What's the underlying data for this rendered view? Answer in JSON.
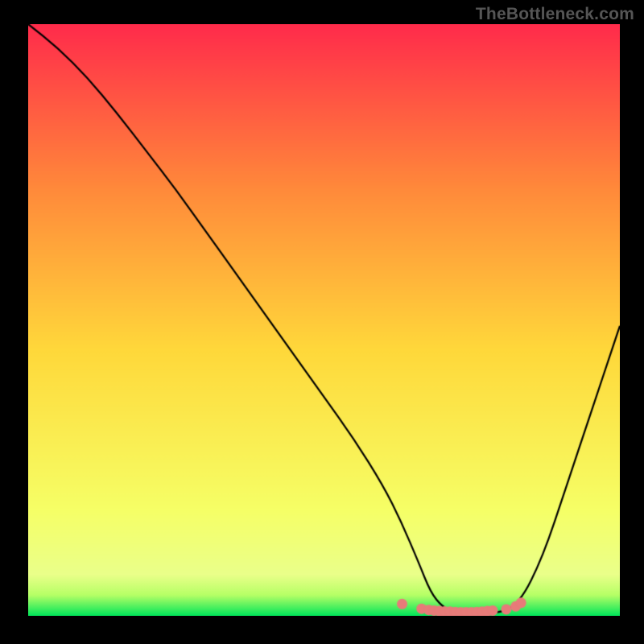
{
  "watermark": "TheBottleneck.com",
  "chart_data": {
    "type": "line",
    "title": "",
    "xlabel": "",
    "ylabel": "",
    "xlim": [
      0,
      100
    ],
    "ylim": [
      0,
      100
    ],
    "gradient": {
      "top": "#ff2b4b",
      "upper_mid": "#ff8a3a",
      "mid": "#ffd83a",
      "lower_mid": "#f6ff66",
      "near_bottom": "#b6ff66",
      "bottom": "#00e55a"
    },
    "curve": {
      "comment": "Black V-shaped bottleneck curve. y is percent bottleneck (100=top). Values read from plot; minimum plateau ~0 around x 68-82.",
      "x": [
        0,
        5,
        10,
        15,
        20,
        25,
        30,
        35,
        40,
        45,
        50,
        55,
        60,
        63,
        66,
        68,
        70,
        72,
        74,
        76,
        78,
        80,
        82,
        84,
        86,
        88,
        90,
        92,
        94,
        96,
        98,
        100
      ],
      "y": [
        100,
        96,
        91,
        85,
        78.5,
        72,
        65,
        58,
        51,
        44,
        37,
        30,
        22,
        16,
        9,
        4,
        1.5,
        0.7,
        0.4,
        0.3,
        0.4,
        0.7,
        1.5,
        4,
        8,
        13,
        19,
        25,
        31,
        37,
        43,
        49
      ]
    },
    "markers": {
      "comment": "Salmon filled dots on the flat bottom of the V, dotted/dashed cluster.",
      "color": "#e77b79",
      "radius": 6.5,
      "x": [
        63.2,
        66.5,
        67.7,
        68.6,
        69.5,
        70.4,
        71.3,
        72.2,
        73.1,
        74.0,
        74.9,
        75.8,
        76.7,
        77.6,
        78.5,
        80.8,
        82.4,
        83.3
      ],
      "y": [
        2.0,
        1.2,
        1.0,
        0.9,
        0.8,
        0.75,
        0.7,
        0.65,
        0.6,
        0.6,
        0.6,
        0.65,
        0.7,
        0.8,
        0.9,
        1.1,
        1.6,
        2.2
      ]
    }
  }
}
